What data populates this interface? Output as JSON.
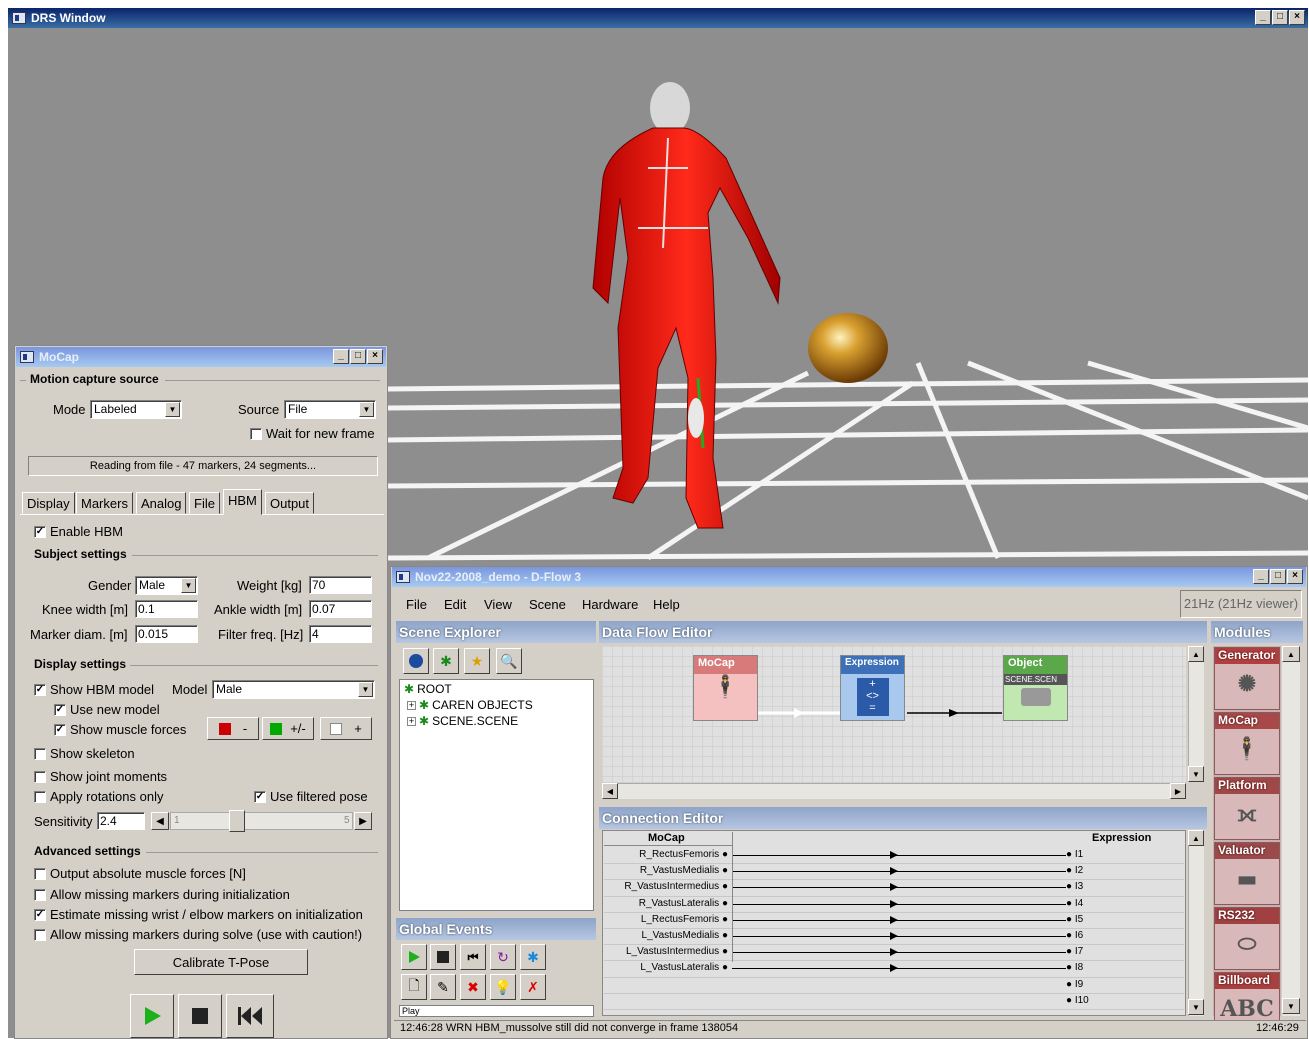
{
  "main_window": {
    "title": "DRS Window"
  },
  "mocap": {
    "title": "MoCap",
    "source_group": "Motion capture source",
    "mode_label": "Mode",
    "mode_value": "Labeled",
    "source_label": "Source",
    "source_value": "File",
    "wait_new_frame": "Wait for new frame",
    "status": "Reading from file - 47 markers, 24 segments...",
    "tabs": [
      "Display",
      "Markers",
      "Analog",
      "File",
      "HBM",
      "Output"
    ],
    "enable_hbm": "Enable HBM",
    "subject_group": "Subject settings",
    "gender_label": "Gender",
    "gender_value": "Male",
    "weight_label": "Weight [kg]",
    "weight_value": "70",
    "knee_label": "Knee width [m]",
    "knee_value": "0.1",
    "ankle_label": "Ankle width [m]",
    "ankle_value": "0.07",
    "marker_label": "Marker diam. [m]",
    "marker_value": "0.015",
    "filter_label": "Filter freq. [Hz]",
    "filter_value": "4",
    "display_group": "Display settings",
    "show_hbm_model": "Show HBM model",
    "model_label": "Model",
    "model_value": "Male",
    "use_new_model": "Use new model",
    "show_muscle_forces": "Show muscle forces",
    "color_btn1": "-",
    "color_btn2": "+/-",
    "color_btn3": "+",
    "show_skeleton": "Show skeleton",
    "show_joint_moments": "Show joint moments",
    "apply_rotations_only": "Apply rotations only",
    "use_filtered_pose": "Use filtered pose",
    "sensitivity_label": "Sensitivity",
    "sensitivity_value": "2.4",
    "slider_min": "1",
    "slider_max": "5",
    "advanced_group": "Advanced settings",
    "adv_1": "Output absolute muscle forces [N]",
    "adv_2": "Allow missing markers during initialization",
    "adv_3": "Estimate missing wrist / elbow markers on initialization",
    "adv_4": "Allow missing markers during solve (use with caution!)",
    "calibrate": "Calibrate T-Pose"
  },
  "dflow": {
    "title": "Nov22-2008_demo - D-Flow 3",
    "menu": [
      "File",
      "Edit",
      "View",
      "Scene",
      "Hardware",
      "Help"
    ],
    "rate": "21Hz (21Hz viewer)",
    "scene_explorer": "Scene Explorer",
    "tree": [
      "ROOT",
      "CAREN OBJECTS",
      "SCENE.SCENE"
    ],
    "data_flow_editor": "Data Flow Editor",
    "nodes": [
      "MoCap",
      "Expression",
      "Object"
    ],
    "object_label": "SCENE.SCEN",
    "modules": "Modules",
    "module_items": [
      "Generator",
      "MoCap",
      "Platform",
      "Valuator",
      "RS232",
      "Billboard"
    ],
    "billboard_text": "ABC",
    "connection_editor": "Connection Editor",
    "conn_left_header": "MoCap",
    "conn_right_header": "Expression",
    "conn_left": [
      "R_RectusFemoris",
      "R_VastusMedialis",
      "R_VastusIntermedius",
      "R_VastusLateralis",
      "L_RectusFemoris",
      "L_VastusMedialis",
      "L_VastusIntermedius",
      "L_VastusLateralis"
    ],
    "conn_right": [
      "I1",
      "I2",
      "I3",
      "I4",
      "I5",
      "I6",
      "I7",
      "I8",
      "I9",
      "I10"
    ],
    "global_events": "Global Events",
    "global_events_partial": "Play",
    "log": "12:46:28 WRN HBM_mussolve still did not converge in frame 138054",
    "clock": "12:46:29"
  },
  "colors": {
    "title_active": "#0a246a",
    "panel": "#d4d0c8",
    "accent_red": "#cc0000",
    "accent_green": "#00aa00"
  }
}
